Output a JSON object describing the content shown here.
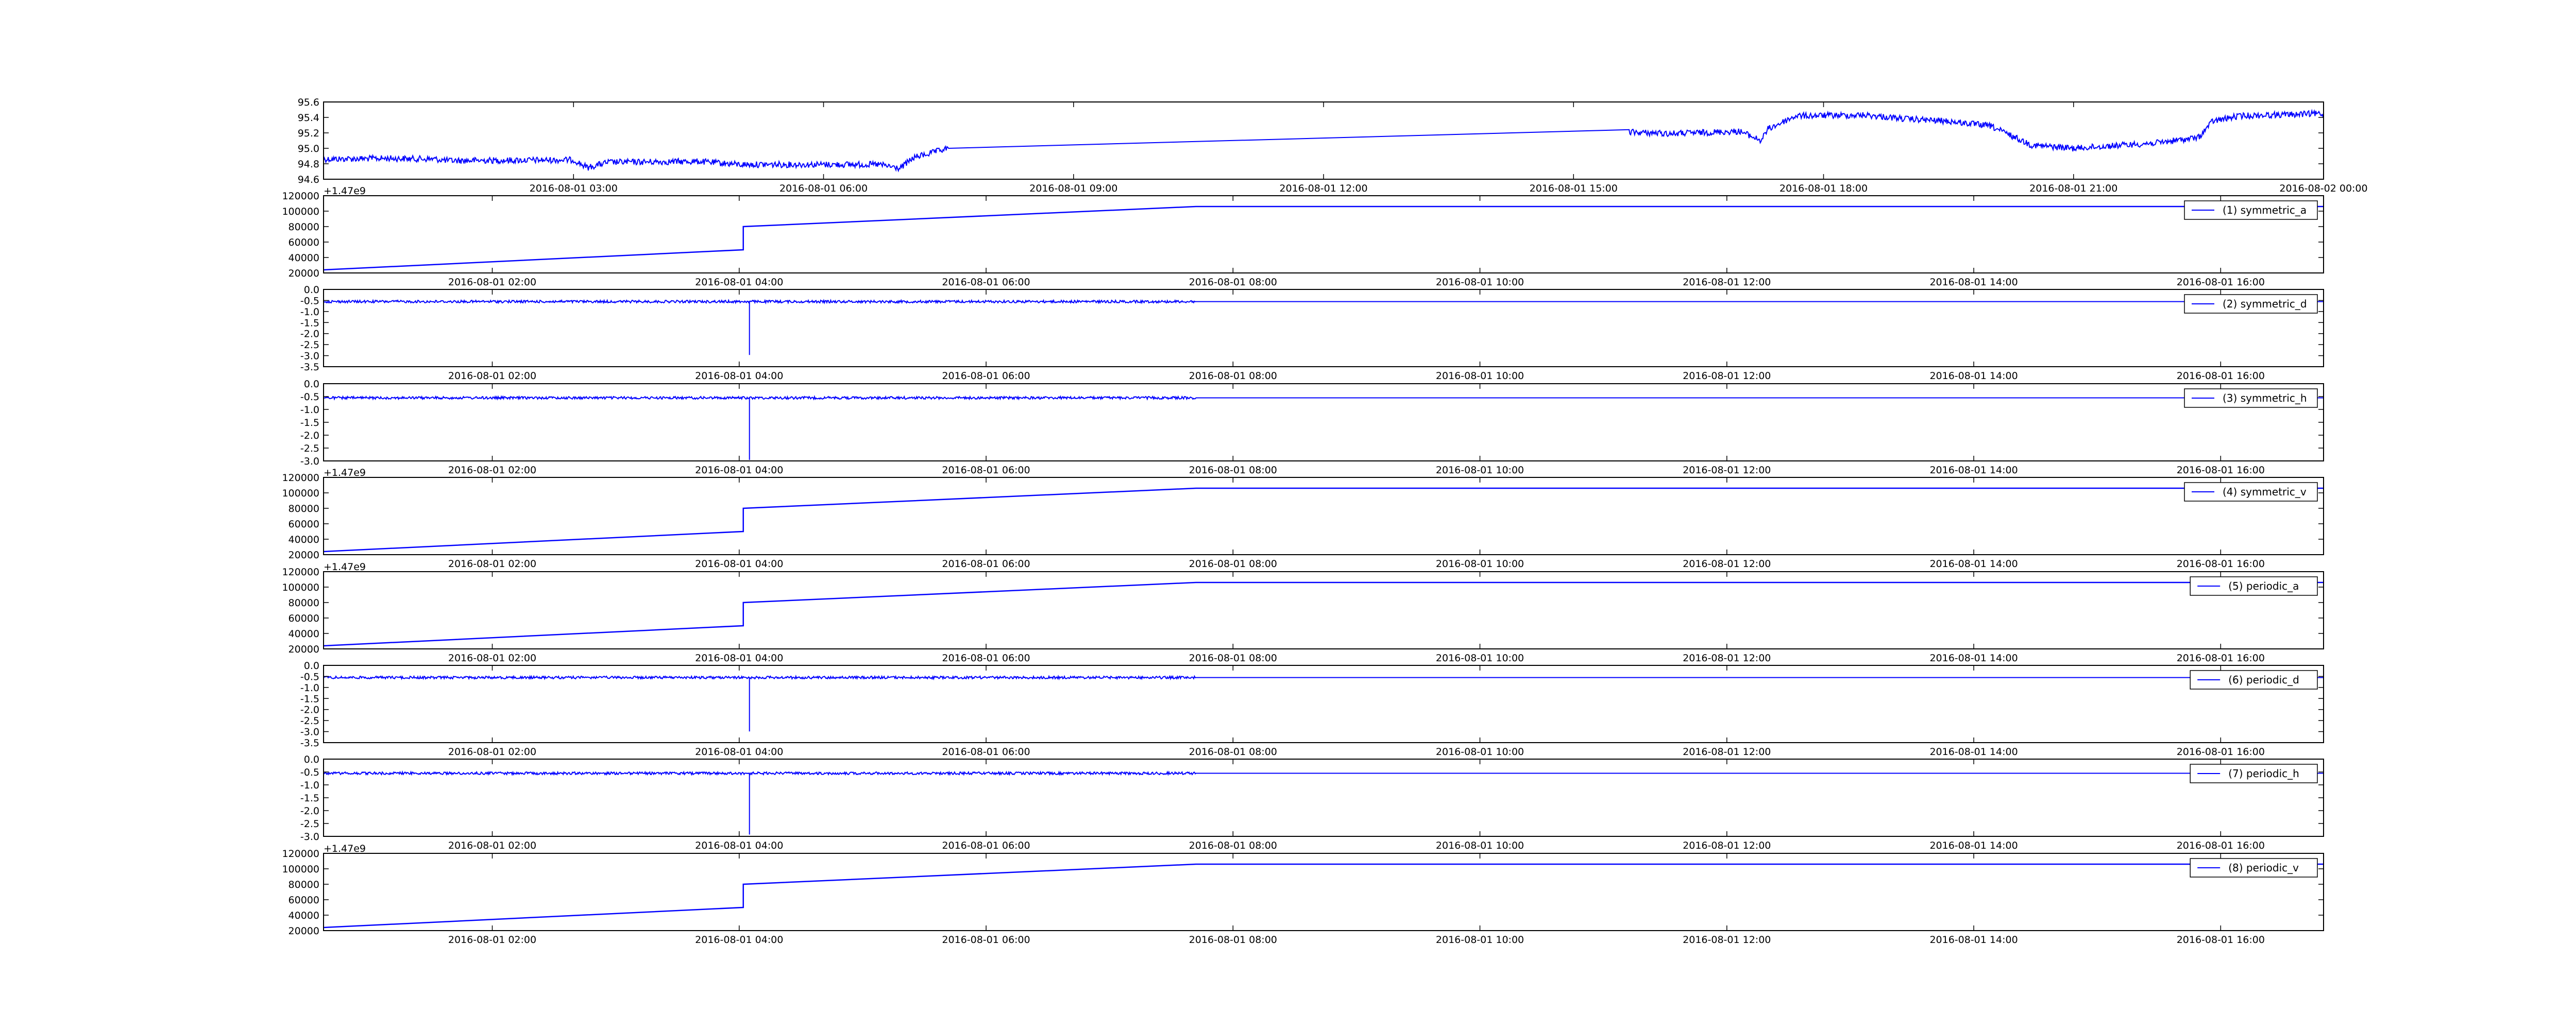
{
  "line_color": "#0000ff",
  "axis_color": "#000000",
  "chart_data": [
    {
      "type": "line",
      "title": "",
      "xlabel": "",
      "ylabel": "",
      "ylim": [
        94.6,
        95.6
      ],
      "xlim": [
        "2016-08-01 00:00",
        "2016-08-02 00:00"
      ],
      "yticks": [
        "94.6",
        "94.8",
        "95.0",
        "95.2",
        "95.4",
        "95.6"
      ],
      "xticks": [
        "2016-08-01 03:00",
        "2016-08-01 06:00",
        "2016-08-01 09:00",
        "2016-08-01 12:00",
        "2016-08-01 15:00",
        "2016-08-01 18:00",
        "2016-08-01 21:00",
        "2016-08-02 00:00"
      ],
      "offset_text": "",
      "legend": "",
      "legend_position": "none",
      "noisy": true,
      "series": [
        {
          "x": [
            "2016-08-01 00:00",
            "2016-08-01 00:45",
            "2016-08-01 01:20",
            "2016-08-01 01:30",
            "2016-08-01 03:00",
            "2016-08-01 03:10",
            "2016-08-01 03:25",
            "2016-08-01 04:30",
            "2016-08-01 05:00",
            "2016-08-01 06:40",
            "2016-08-01 06:55",
            "2016-08-01 07:05",
            "2016-08-01 07:30",
            "2016-08-01 15:40",
            "2016-08-01 16:10",
            "2016-08-01 17:00",
            "2016-08-01 17:15",
            "2016-08-01 17:20",
            "2016-08-01 17:40",
            "2016-08-01 18:30",
            "2016-08-01 19:00",
            "2016-08-01 19:30",
            "2016-08-01 20:00",
            "2016-08-01 20:30",
            "2016-08-01 21:00",
            "2016-08-01 22:00",
            "2016-08-01 22:30",
            "2016-08-01 22:40",
            "2016-08-01 23:00",
            "2016-08-02 00:00"
          ],
          "y": [
            94.86,
            94.87,
            94.86,
            94.84,
            94.85,
            94.75,
            94.82,
            94.83,
            94.79,
            94.79,
            94.74,
            94.88,
            95.0,
            95.21,
            95.19,
            95.22,
            95.1,
            95.25,
            95.42,
            95.43,
            95.38,
            95.35,
            95.29,
            95.04,
            95.0,
            95.07,
            95.14,
            95.35,
            95.42,
            95.45
          ]
        }
      ]
    },
    {
      "type": "line",
      "title": "",
      "xlabel": "",
      "ylabel": "",
      "ylim": [
        20000,
        120000
      ],
      "xlim": [
        "2016-08-01 00:38",
        "2016-08-01 16:50"
      ],
      "yticks": [
        "20000",
        "40000",
        "60000",
        "80000",
        "100000",
        "120000"
      ],
      "xticks": [
        "2016-08-01 02:00",
        "2016-08-01 04:00",
        "2016-08-01 06:00",
        "2016-08-01 08:00",
        "2016-08-01 10:00",
        "2016-08-01 12:00",
        "2016-08-01 14:00",
        "2016-08-01 16:00"
      ],
      "offset_text": "+1.47e9",
      "legend": "(1) symmetric_a",
      "legend_position": "top-right",
      "noisy": false,
      "series": [
        {
          "x": [
            "2016-08-01 00:38",
            "2016-08-01 04:02",
            "2016-08-01 04:02",
            "2016-08-01 07:42",
            "2016-08-01 16:50"
          ],
          "y": [
            24000,
            50000,
            80000,
            106000,
            106000
          ]
        }
      ]
    },
    {
      "type": "line",
      "title": "",
      "xlabel": "",
      "ylabel": "",
      "ylim": [
        -3.5,
        0.0
      ],
      "xlim": [
        "2016-08-01 00:38",
        "2016-08-01 16:50"
      ],
      "yticks": [
        "-3.5",
        "-3.0",
        "-2.5",
        "-2.0",
        "-1.5",
        "-1.0",
        "-0.5",
        "0.0"
      ],
      "xticks": [
        "2016-08-01 02:00",
        "2016-08-01 04:00",
        "2016-08-01 06:00",
        "2016-08-01 08:00",
        "2016-08-01 10:00",
        "2016-08-01 12:00",
        "2016-08-01 14:00",
        "2016-08-01 16:00"
      ],
      "offset_text": "",
      "legend": "(2) symmetric_d",
      "legend_position": "top-right",
      "noisy": true,
      "series": [
        {
          "x": [
            "2016-08-01 00:38",
            "2016-08-01 04:05",
            "2016-08-01 04:05",
            "2016-08-01 04:05",
            "2016-08-01 07:42",
            "2016-08-01 16:50"
          ],
          "y": [
            -0.55,
            -0.55,
            -3.0,
            -0.55,
            -0.55,
            -0.55
          ]
        }
      ]
    },
    {
      "type": "line",
      "title": "",
      "xlabel": "",
      "ylabel": "",
      "ylim": [
        -3.0,
        0.0
      ],
      "xlim": [
        "2016-08-01 00:38",
        "2016-08-01 16:50"
      ],
      "yticks": [
        "-3.0",
        "-2.5",
        "-2.0",
        "-1.5",
        "-1.0",
        "-0.5",
        "0.0"
      ],
      "xticks": [
        "2016-08-01 02:00",
        "2016-08-01 04:00",
        "2016-08-01 06:00",
        "2016-08-01 08:00",
        "2016-08-01 10:00",
        "2016-08-01 12:00",
        "2016-08-01 14:00",
        "2016-08-01 16:00"
      ],
      "offset_text": "",
      "legend": "(3) symmetric_h",
      "legend_position": "top-right",
      "noisy": true,
      "series": [
        {
          "x": [
            "2016-08-01 00:38",
            "2016-08-01 04:05",
            "2016-08-01 04:05",
            "2016-08-01 04:05",
            "2016-08-01 07:42",
            "2016-08-01 16:50"
          ],
          "y": [
            -0.55,
            -0.55,
            -3.0,
            -0.55,
            -0.55,
            -0.55
          ]
        }
      ]
    },
    {
      "type": "line",
      "title": "",
      "xlabel": "",
      "ylabel": "",
      "ylim": [
        20000,
        120000
      ],
      "xlim": [
        "2016-08-01 00:38",
        "2016-08-01 16:50"
      ],
      "yticks": [
        "20000",
        "40000",
        "60000",
        "80000",
        "100000",
        "120000"
      ],
      "xticks": [
        "2016-08-01 02:00",
        "2016-08-01 04:00",
        "2016-08-01 06:00",
        "2016-08-01 08:00",
        "2016-08-01 10:00",
        "2016-08-01 12:00",
        "2016-08-01 14:00",
        "2016-08-01 16:00"
      ],
      "offset_text": "+1.47e9",
      "legend": "(4) symmetric_v",
      "legend_position": "top-right",
      "noisy": false,
      "series": [
        {
          "x": [
            "2016-08-01 00:38",
            "2016-08-01 04:02",
            "2016-08-01 04:02",
            "2016-08-01 07:42",
            "2016-08-01 16:50"
          ],
          "y": [
            24000,
            50000,
            80000,
            106000,
            106000
          ]
        }
      ]
    },
    {
      "type": "line",
      "title": "",
      "xlabel": "",
      "ylabel": "",
      "ylim": [
        20000,
        120000
      ],
      "xlim": [
        "2016-08-01 00:38",
        "2016-08-01 16:50"
      ],
      "yticks": [
        "20000",
        "40000",
        "60000",
        "80000",
        "100000",
        "120000"
      ],
      "xticks": [
        "2016-08-01 02:00",
        "2016-08-01 04:00",
        "2016-08-01 06:00",
        "2016-08-01 08:00",
        "2016-08-01 10:00",
        "2016-08-01 12:00",
        "2016-08-01 14:00",
        "2016-08-01 16:00"
      ],
      "offset_text": "+1.47e9",
      "legend": "(5) periodic_a",
      "legend_position": "top-right",
      "noisy": false,
      "series": [
        {
          "x": [
            "2016-08-01 00:38",
            "2016-08-01 04:02",
            "2016-08-01 04:02",
            "2016-08-01 07:42",
            "2016-08-01 16:50"
          ],
          "y": [
            24000,
            50000,
            80000,
            106000,
            106000
          ]
        }
      ]
    },
    {
      "type": "line",
      "title": "",
      "xlabel": "",
      "ylabel": "",
      "ylim": [
        -3.5,
        0.0
      ],
      "xlim": [
        "2016-08-01 00:38",
        "2016-08-01 16:50"
      ],
      "yticks": [
        "-3.5",
        "-3.0",
        "-2.5",
        "-2.0",
        "-1.5",
        "-1.0",
        "-0.5",
        "0.0"
      ],
      "xticks": [
        "2016-08-01 02:00",
        "2016-08-01 04:00",
        "2016-08-01 06:00",
        "2016-08-01 08:00",
        "2016-08-01 10:00",
        "2016-08-01 12:00",
        "2016-08-01 14:00",
        "2016-08-01 16:00"
      ],
      "offset_text": "",
      "legend": "(6) periodic_d",
      "legend_position": "top-right",
      "noisy": true,
      "series": [
        {
          "x": [
            "2016-08-01 00:38",
            "2016-08-01 04:05",
            "2016-08-01 04:05",
            "2016-08-01 04:05",
            "2016-08-01 07:42",
            "2016-08-01 16:50"
          ],
          "y": [
            -0.55,
            -0.55,
            -3.0,
            -0.55,
            -0.55,
            -0.55
          ]
        }
      ]
    },
    {
      "type": "line",
      "title": "",
      "xlabel": "",
      "ylabel": "",
      "ylim": [
        -3.0,
        0.0
      ],
      "xlim": [
        "2016-08-01 00:38",
        "2016-08-01 16:50"
      ],
      "yticks": [
        "-3.0",
        "-2.5",
        "-2.0",
        "-1.5",
        "-1.0",
        "-0.5",
        "0.0"
      ],
      "xticks": [
        "2016-08-01 02:00",
        "2016-08-01 04:00",
        "2016-08-01 06:00",
        "2016-08-01 08:00",
        "2016-08-01 10:00",
        "2016-08-01 12:00",
        "2016-08-01 14:00",
        "2016-08-01 16:00"
      ],
      "offset_text": "",
      "legend": "(7) periodic_h",
      "legend_position": "top-right",
      "noisy": true,
      "series": [
        {
          "x": [
            "2016-08-01 00:38",
            "2016-08-01 04:05",
            "2016-08-01 04:05",
            "2016-08-01 04:05",
            "2016-08-01 07:42",
            "2016-08-01 16:50"
          ],
          "y": [
            -0.55,
            -0.55,
            -2.95,
            -0.55,
            -0.55,
            -0.55
          ]
        }
      ]
    },
    {
      "type": "line",
      "title": "",
      "xlabel": "",
      "ylabel": "",
      "ylim": [
        20000,
        120000
      ],
      "xlim": [
        "2016-08-01 00:38",
        "2016-08-01 16:50"
      ],
      "yticks": [
        "20000",
        "40000",
        "60000",
        "80000",
        "100000",
        "120000"
      ],
      "xticks": [
        "2016-08-01 02:00",
        "2016-08-01 04:00",
        "2016-08-01 06:00",
        "2016-08-01 08:00",
        "2016-08-01 10:00",
        "2016-08-01 12:00",
        "2016-08-01 14:00",
        "2016-08-01 16:00"
      ],
      "offset_text": "+1.47e9",
      "legend": "(8) periodic_v",
      "legend_position": "top-right",
      "noisy": false,
      "series": [
        {
          "x": [
            "2016-08-01 00:38",
            "2016-08-01 04:02",
            "2016-08-01 04:02",
            "2016-08-01 07:42",
            "2016-08-01 16:50"
          ],
          "y": [
            24000,
            50000,
            80000,
            106000,
            106000
          ]
        }
      ]
    }
  ]
}
